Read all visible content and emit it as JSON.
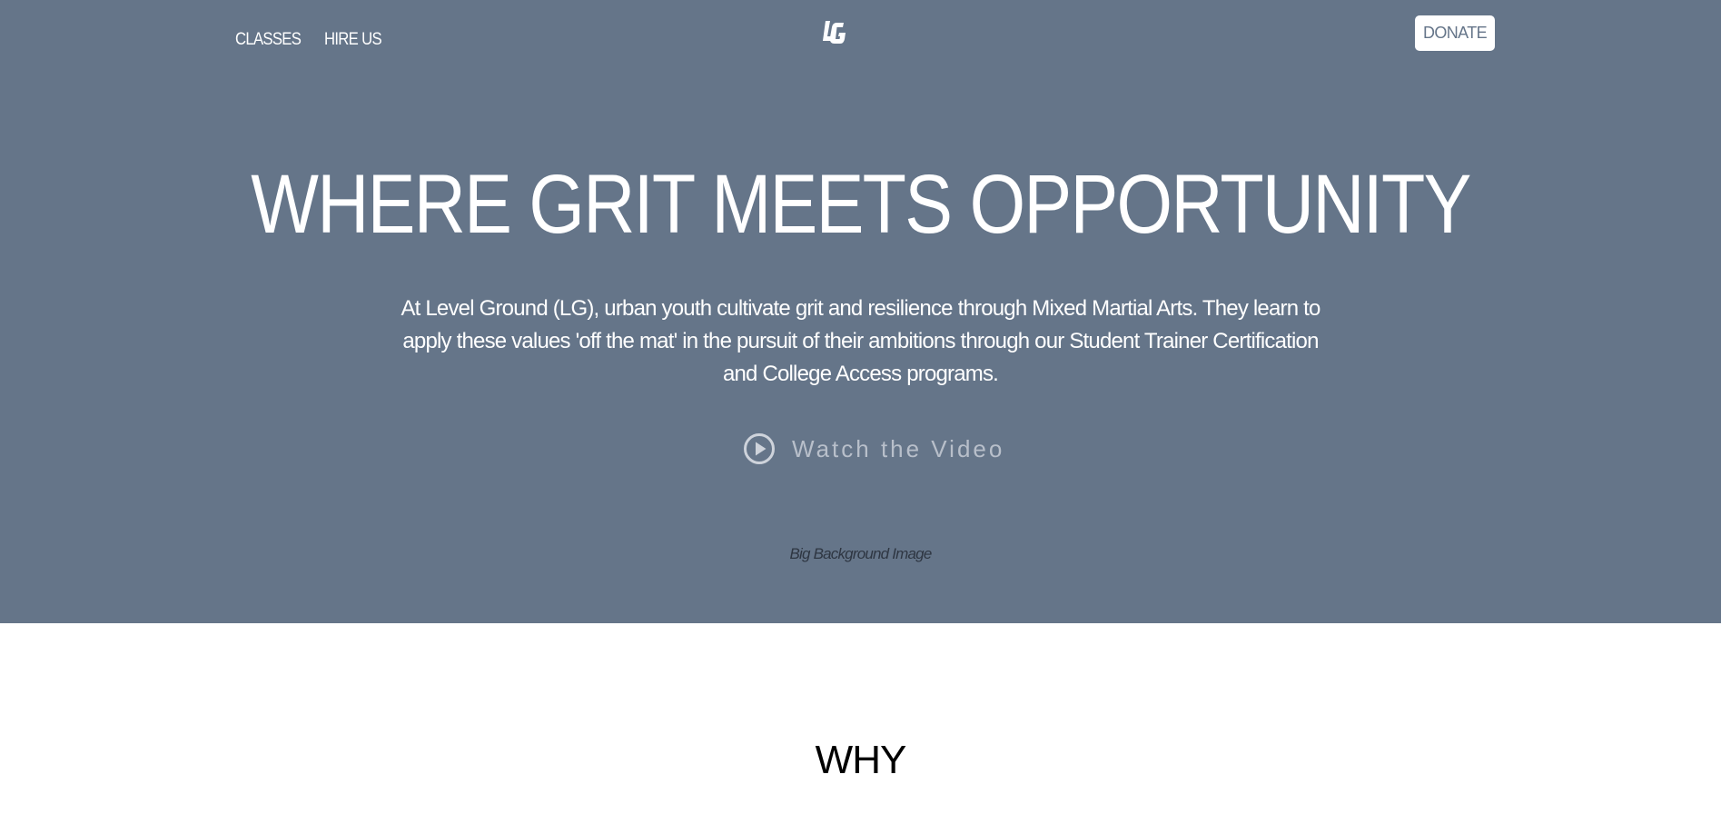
{
  "nav": {
    "links": [
      {
        "label": "CLASSES"
      },
      {
        "label": "HIRE US"
      }
    ],
    "logo_text": "LG",
    "donate_label": "DONATE"
  },
  "hero": {
    "headline": "WHERE GRIT MEETS OPPORTUNITY",
    "intro": "At Level Ground (LG), urban youth cultivate grit and resilience through Mixed Martial Arts. They learn to apply these values 'off the mat' in the pursuit of their ambitions through our Student Trainer Certification and College Access programs.",
    "watch_label": "Watch the Video",
    "watch_icon": "play-circle-icon",
    "background_caption": "Big Background Image",
    "background_color": "#657589"
  },
  "sections": {
    "why_title": "WHY"
  }
}
